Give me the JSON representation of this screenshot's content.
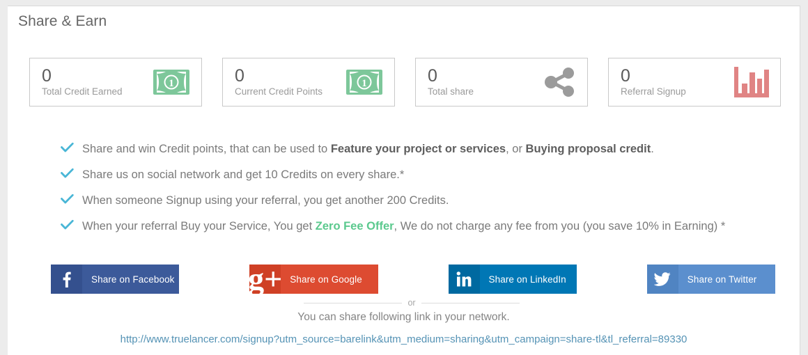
{
  "panel": {
    "title": "Share & Earn"
  },
  "stats": [
    {
      "value": "0",
      "label": "Total Credit Earned",
      "icon": "banknote-icon",
      "icon_color": "#7dc79a"
    },
    {
      "value": "0",
      "label": "Current Credit Points",
      "icon": "banknote-icon",
      "icon_color": "#7dc79a"
    },
    {
      "value": "0",
      "label": "Total share",
      "icon": "share-nodes-icon",
      "icon_color": "#9b9b9b"
    },
    {
      "value": "0",
      "label": "Referral Signup",
      "icon": "bar-chart-icon",
      "icon_color": "#e08484"
    }
  ],
  "benefits": [
    {
      "icon": "check-icon",
      "parts": [
        {
          "text": "Share and win Credit points, that can be used to ",
          "style": "normal"
        },
        {
          "text": "Feature your project or services",
          "style": "bold"
        },
        {
          "text": ", or ",
          "style": "normal"
        },
        {
          "text": "Buying proposal credit",
          "style": "bold"
        },
        {
          "text": ".",
          "style": "normal"
        }
      ]
    },
    {
      "icon": "check-icon",
      "parts": [
        {
          "text": "Share us on social network and get 10 Credits on every share.*",
          "style": "normal"
        }
      ]
    },
    {
      "icon": "check-icon",
      "parts": [
        {
          "text": "When someone Signup using your referral, you get another 200 Credits.",
          "style": "normal"
        }
      ]
    },
    {
      "icon": "check-icon",
      "parts": [
        {
          "text": "When your referral Buy your Service, You get ",
          "style": "normal"
        },
        {
          "text": "Zero Fee Offer",
          "style": "accent"
        },
        {
          "text": ", We do not charge any fee from you (you save 10% in Earning) *",
          "style": "normal"
        }
      ]
    }
  ],
  "share_buttons": [
    {
      "label": "Share on Facebook",
      "network": "facebook",
      "icon": "facebook-icon",
      "color": "#3c5a9a"
    },
    {
      "label": "Share on Google",
      "network": "google",
      "icon": "google-plus-icon",
      "color": "#dd4b31"
    },
    {
      "label": "Share on LinkedIn",
      "network": "linkedin",
      "icon": "linkedin-icon",
      "color": "#0077b5"
    },
    {
      "label": "Share on Twitter",
      "network": "twitter",
      "icon": "twitter-icon",
      "color": "#5b8fce"
    }
  ],
  "divider": {
    "or_label": "or"
  },
  "share_link_section": {
    "note": "You can share following link in your network.",
    "url": "http://www.truelancer.com/signup?utm_source=barelink&utm_medium=sharing&utm_campaign=share-tl&tl_referral=89330"
  },
  "colors": {
    "accent_green": "#5bc98e",
    "check_blue": "#49b6d6",
    "link_blue": "#5593b5",
    "text_gray": "#7a7a7a"
  }
}
